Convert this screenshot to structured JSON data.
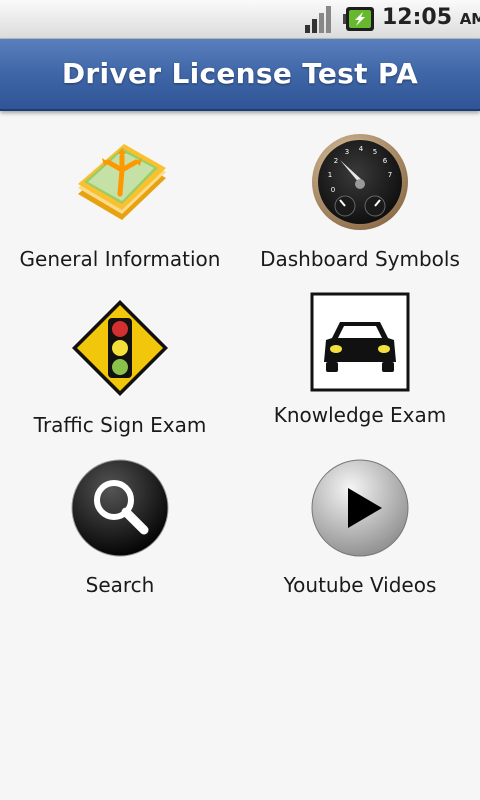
{
  "status_bar": {
    "time": "12:05",
    "ampm": "AM",
    "icons": [
      "signal-icon",
      "battery-charging-icon"
    ],
    "colors": {
      "battery": "#66b82e"
    }
  },
  "app_bar": {
    "title": "Driver License Test PA",
    "colors": {
      "bar": "#3f66a7"
    }
  },
  "menu": {
    "items": [
      {
        "label": "General Information",
        "icon": "book-directions-icon"
      },
      {
        "label": "Dashboard Symbols",
        "icon": "speedometer-icon"
      },
      {
        "label": "Traffic Sign Exam",
        "icon": "traffic-light-sign-icon"
      },
      {
        "label": "Knowledge Exam",
        "icon": "car-icon"
      },
      {
        "label": "Search",
        "icon": "search-icon"
      },
      {
        "label": "Youtube Videos",
        "icon": "play-icon"
      }
    ]
  }
}
